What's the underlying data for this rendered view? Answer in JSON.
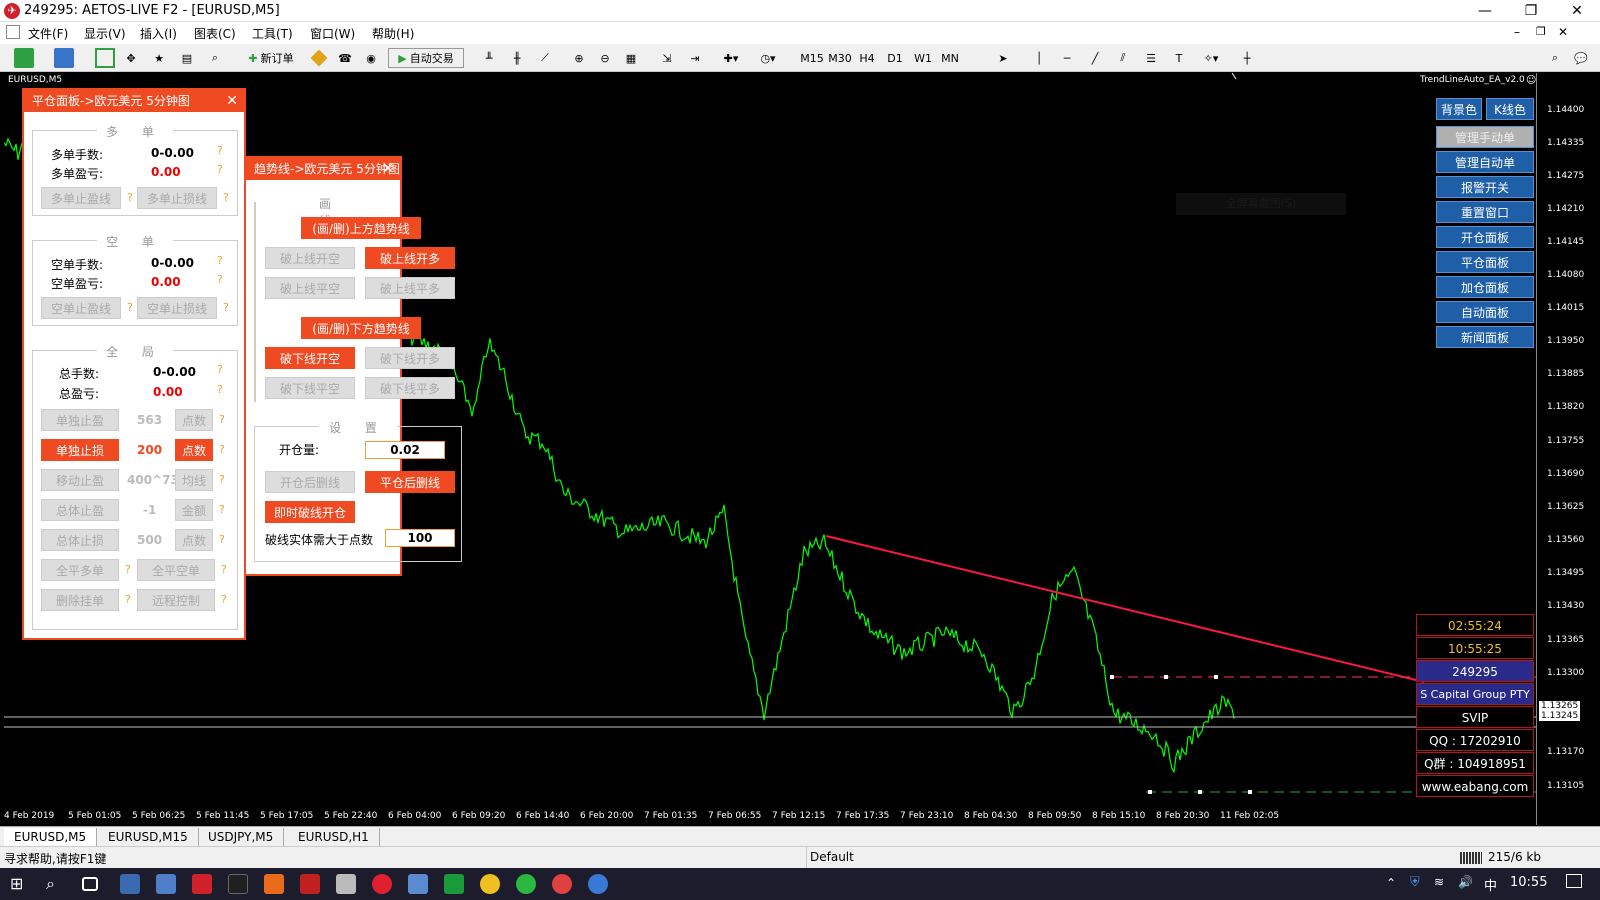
{
  "window": {
    "title": "249295: AETOS-LIVE F2 - [EURUSD,M5]"
  },
  "menu": [
    "文件(F)",
    "显示(V)",
    "插入(I)",
    "图表(C)",
    "工具(T)",
    "窗口(W)",
    "帮助(H)"
  ],
  "toolbar": {
    "new_order": "新订单",
    "auto_trade": "自动交易",
    "timeframes": [
      "M15",
      "M30",
      "H4",
      "D1",
      "W1",
      "MN"
    ]
  },
  "chart": {
    "symbol_label": "EURUSD,M5",
    "ea_label": "TrendLineAuto_EA_v2.0",
    "hidden_label": "全屏幕截图(S)",
    "price_ticks": [
      "1.14400",
      "1.14335",
      "1.14275",
      "1.14210",
      "1.14145",
      "1.14080",
      "1.14015",
      "1.13950",
      "1.13885",
      "1.13820",
      "1.13755",
      "1.13690",
      "1.13625",
      "1.13560",
      "1.13495",
      "1.13430",
      "1.13365",
      "1.13300",
      "1.13265",
      "1.13245",
      "1.13170",
      "1.13105"
    ],
    "time_ticks": [
      "4 Feb 2019",
      "5 Feb 01:05",
      "5 Feb 06:25",
      "5 Feb 11:45",
      "5 Feb 17:05",
      "5 Feb 22:40",
      "6 Feb 04:00",
      "6 Feb 09:20",
      "6 Feb 14:40",
      "6 Feb 20:00",
      "7 Feb 01:35",
      "7 Feb 06:55",
      "7 Feb 12:15",
      "7 Feb 17:35",
      "7 Feb 23:10",
      "8 Feb 04:30",
      "8 Feb 09:50",
      "8 Feb 15:10",
      "8 Feb 20:30",
      "11 Feb 02:05"
    ],
    "colors": {
      "candle": "#00ff00",
      "trendline": "#ff1744",
      "hline": "#c0c0c0"
    }
  },
  "close_panel": {
    "title": "平仓面板->欧元美元 5分钟图",
    "long": {
      "title": "多 单",
      "lots_label": "多单手数:",
      "lots": "0-0.00",
      "profit_label": "多单盈亏:",
      "profit": "0.00",
      "tp_btn": "多单止盈线",
      "sl_btn": "多单止损线"
    },
    "short": {
      "title": "空 单",
      "lots_label": "空单手数:",
      "lots": "0-0.00",
      "profit_label": "空单盈亏:",
      "profit": "0.00",
      "tp_btn": "空单止盈线",
      "sl_btn": "空单止损线"
    },
    "global": {
      "title": "全 局",
      "lots_label": "总手数:",
      "lots": "0-0.00",
      "profit_label": "总盈亏:",
      "profit": "0.00",
      "rows": [
        {
          "btn": "单独止盈",
          "val": "563",
          "unit": "点数",
          "on": false
        },
        {
          "btn": "单独止损",
          "val": "200",
          "unit": "点数",
          "on": true
        },
        {
          "btn": "移动止盈",
          "val": "400^73",
          "unit": "均线",
          "on": false
        },
        {
          "btn": "总体止盈",
          "val": "-1",
          "unit": "金额",
          "on": false
        },
        {
          "btn": "总体止损",
          "val": "500",
          "unit": "点数",
          "on": false
        }
      ],
      "close_long": "全平多单",
      "close_short": "全平空单",
      "del_pending": "删除挂单",
      "remote": "远程控制"
    },
    "help": "?"
  },
  "trend_panel": {
    "title": "趋势线->欧元美元 5分钟图",
    "draw": {
      "title": "画 线",
      "upper": "(画/删)上方趋势线",
      "break_up_short": "破上线开空",
      "break_up_long": "破上线开多",
      "break_up_close_short": "破上线平空",
      "break_up_close_long": "破上线平多",
      "lower": "(画/删)下方趋势线",
      "break_dn_short": "破下线开空",
      "break_dn_long": "破下线开多",
      "break_dn_close_short": "破下线平空",
      "break_dn_close_long": "破下线平多"
    },
    "settings": {
      "title": "设 置",
      "lot_label": "开仓量:",
      "lot": "0.02",
      "del_after_open": "开仓后删线",
      "del_after_close": "平仓后删线",
      "instant": "即时破线开仓",
      "body_label": "破线实体需大于点数",
      "body": "100"
    }
  },
  "right_panel": {
    "buttons": [
      "背景色",
      "K线色",
      "管理手动单",
      "管理自动单",
      "报警开关",
      "重置窗口",
      "开仓面板",
      "平仓面板",
      "加仓面板",
      "自动面板",
      "新闻面板"
    ]
  },
  "info": {
    "time1": "02:55:24",
    "time2": "10:55:25",
    "account": "249295",
    "company": "S Capital Group PTY",
    "level": "SVIP",
    "qq": "QQ : 17202910",
    "qgroup": "Q群 : 104918951",
    "site": "www.eabang.com"
  },
  "tabs": [
    "EURUSD,M5",
    "EURUSD,M15",
    "USDJPY,M5",
    "EURUSD,H1"
  ],
  "status": {
    "help": "寻求帮助,请按F1键",
    "profile": "Default",
    "traffic": "215/6 kb"
  },
  "taskbar": {
    "time": "10:55",
    "ime": "中"
  }
}
